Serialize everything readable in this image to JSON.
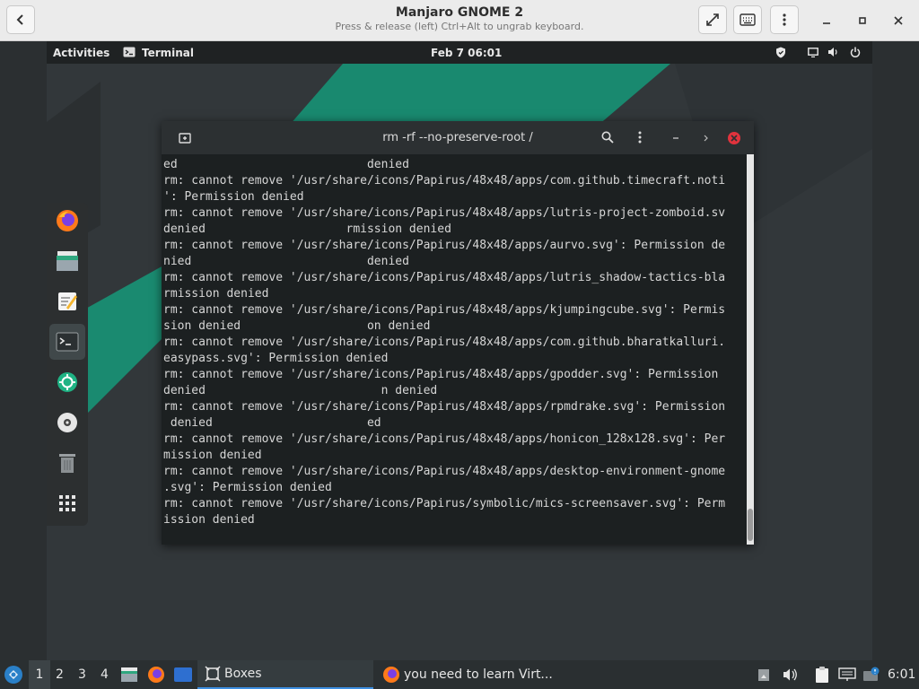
{
  "boxes": {
    "title": "Manjaro GNOME 2",
    "subtitle": "Press & release (left) Ctrl+Alt to ungrab keyboard."
  },
  "gnome": {
    "activities": "Activities",
    "app_name": "Terminal",
    "clock": "Feb 7  06:01"
  },
  "terminal": {
    "title": "rm -rf --no-preserve-root /",
    "lines": [
      "ed                           denied",
      "rm: cannot remove '/usr/share/icons/Papirus/48x48/apps/com.github.timecraft.noti",
      "': Permission denied",
      "rm: cannot remove '/usr/share/icons/Papirus/48x48/apps/lutris-project-zomboid.sv",
      "denied                    rmission denied",
      "rm: cannot remove '/usr/share/icons/Papirus/48x48/apps/aurvo.svg': Permission de",
      "nied                         denied",
      "rm: cannot remove '/usr/share/icons/Papirus/48x48/apps/lutris_shadow-tactics-bla",
      "rmission denied",
      "rm: cannot remove '/usr/share/icons/Papirus/48x48/apps/kjumpingcube.svg': Permis",
      "sion denied                  on denied",
      "rm: cannot remove '/usr/share/icons/Papirus/48x48/apps/com.github.bharatkalluri.",
      "easypass.svg': Permission denied",
      "rm: cannot remove '/usr/share/icons/Papirus/48x48/apps/gpodder.svg': Permission",
      "denied                         n denied",
      "rm: cannot remove '/usr/share/icons/Papirus/48x48/apps/rpmdrake.svg': Permission",
      " denied                      ed",
      "rm: cannot remove '/usr/share/icons/Papirus/48x48/apps/honicon_128x128.svg': Per",
      "mission denied",
      "rm: cannot remove '/usr/share/icons/Papirus/48x48/apps/desktop-environment-gnome",
      ".svg': Permission denied",
      "rm: cannot remove '/usr/share/icons/Papirus/symbolic/mics-screensaver.svg': Perm",
      "ission denied"
    ]
  },
  "taskbar": {
    "workspaces": [
      "1",
      "2",
      "3",
      "4"
    ],
    "boxes_label": "Boxes",
    "firefox_label": "you need to learn Virt...",
    "clock": "6:01"
  },
  "colors": {
    "accent_green": "#19896f",
    "terminal_bg": "#1c2021",
    "close_red": "#e0333d"
  }
}
